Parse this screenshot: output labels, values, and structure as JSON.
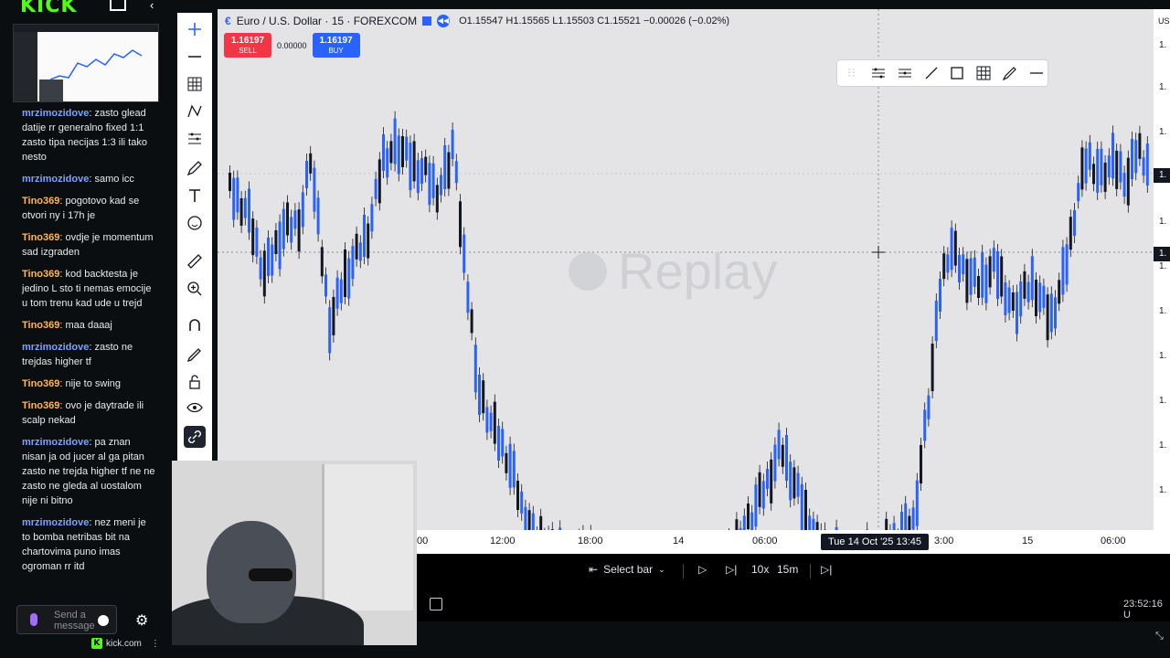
{
  "kick": {
    "logo": "KICK",
    "footer_domain": "kick.com",
    "chat_placeholder": "Send a message"
  },
  "chat": [
    {
      "user": "mrzimozidove",
      "color": "#7aa2ff",
      "text": "zasto glead datije rr generalno fixed 1:1 zasto tipa necijas 1:3 ili tako nesto"
    },
    {
      "user": "mrzimozidove",
      "color": "#7aa2ff",
      "text": "samo icc"
    },
    {
      "user": "Tino369",
      "color": "#ffb84d",
      "text": "pogotovo kad se otvori ny i 17h je"
    },
    {
      "user": "Tino369",
      "color": "#ffb84d",
      "text": "ovdje je momentum sad izgraden"
    },
    {
      "user": "Tino369",
      "color": "#ffb84d",
      "text": "kod backtesta je jedino L sto ti nemas emocije u tom trenu kad ude u trejd"
    },
    {
      "user": "Tino369",
      "color": "#ffb84d",
      "text": "maa daaaj"
    },
    {
      "user": "mrzimozidove",
      "color": "#7aa2ff",
      "text": "zasto ne trejdas higher tf"
    },
    {
      "user": "Tino369",
      "color": "#ffb84d",
      "text": "nije to swing"
    },
    {
      "user": "Tino369",
      "color": "#ffb84d",
      "text": "ovo je daytrade ili scalp nekad"
    },
    {
      "user": "mrzimozidove",
      "color": "#7aa2ff",
      "text": "pa znan nisan ja od jucer al ga pitan zasto ne trejda higher tf ne ne zasto ne gleda al uostalom nije ni bitno"
    },
    {
      "user": "mrzimozidove",
      "color": "#7aa2ff",
      "text": "nez meni je to bomba netribas bit na chartovima puno imas ogroman rr itd"
    }
  ],
  "symbol": {
    "name": "Euro / U.S. Dollar · 15 · FOREXCOM",
    "ohlc": "O1.15547 H1.15565 L1.15503 C1.15521 −0.00026 (−0.02%)"
  },
  "trade": {
    "sell_price": "1.16197",
    "sell_label": "SELL",
    "spread": "0.00000",
    "buy_price": "1.16197",
    "buy_label": "BUY"
  },
  "watermark": "Replay",
  "price_axis": {
    "currency": "US",
    "tags": [
      "1.",
      "1."
    ],
    "labels": [
      "1.",
      "1.",
      "1.",
      "1.",
      "1.",
      "1.",
      "1.",
      "1.",
      "1.",
      "1.",
      "1."
    ]
  },
  "time_axis": {
    "labels": [
      "00",
      "12:00",
      "18:00",
      "14",
      "06:00",
      "3:00",
      "15",
      "06:00"
    ],
    "crosshair": "Tue 14 Oct '25   13:45"
  },
  "replay": {
    "select_bar": "Select bar",
    "speed": "10x",
    "interval": "15m"
  },
  "status": {
    "clock": "23:52:16 U"
  },
  "colors": {
    "up_candle": "#2962ff",
    "down_candle": "#131722",
    "chart_bg": "#e4e4e6",
    "sell": "#f23645",
    "buy": "#2962ff",
    "kick_green": "#53fc18"
  }
}
